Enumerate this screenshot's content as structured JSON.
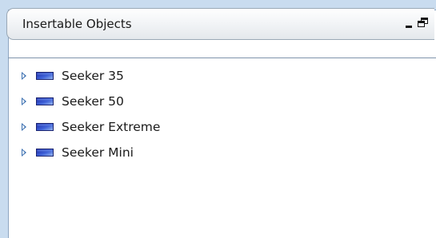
{
  "panel": {
    "title": "Insertable Objects",
    "controls": {
      "minimize_icon": "minimize-icon",
      "restore_icon": "restore-icon"
    }
  },
  "tree": {
    "items": [
      {
        "label": "Seeker 35",
        "icon": "seeker-object-icon",
        "expanded": false
      },
      {
        "label": "Seeker 50",
        "icon": "seeker-object-icon",
        "expanded": false
      },
      {
        "label": "Seeker Extreme",
        "icon": "seeker-object-icon",
        "expanded": false
      },
      {
        "label": "Seeker Mini",
        "icon": "seeker-object-icon",
        "expanded": false
      }
    ]
  },
  "colors": {
    "expander": "#3a6fb0",
    "icon_gradient_start": "#1d2aa8",
    "icon_gradient_end": "#8ab0ee",
    "panel_border": "#7f93ab"
  }
}
